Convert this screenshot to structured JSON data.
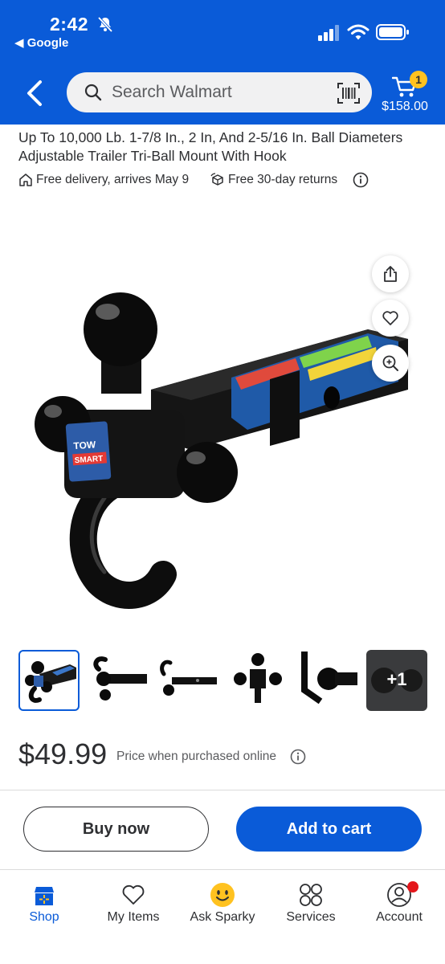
{
  "status_bar": {
    "time": "2:42",
    "back_app": "◀ Google"
  },
  "header": {
    "search_placeholder": "Search Walmart",
    "cart_count": "1",
    "cart_total": "$158.00"
  },
  "product": {
    "title_line1": "Up To 10,000 Lb. 1-7/8 In., 2 In, And 2-5/16 In. Ball Diameters",
    "title_line2": "Adjustable Trailer Tri-Ball Mount With Hook",
    "delivery": "Free delivery, arrives May 9",
    "returns": "Free 30-day returns",
    "brand_line1": "TOW",
    "brand_line2": "SMART",
    "price": "$49.99",
    "price_note": "Price when purchased online"
  },
  "gallery": {
    "more_label": "+1"
  },
  "actions": {
    "buy_now": "Buy now",
    "add_to_cart": "Add to cart"
  },
  "bottom_nav": {
    "tabs": [
      {
        "label": "Shop"
      },
      {
        "label": "My Items"
      },
      {
        "label": "Ask Sparky"
      },
      {
        "label": "Services"
      },
      {
        "label": "Account"
      }
    ]
  },
  "colors": {
    "brand_blue": "#0a5bd8",
    "spark_yellow": "#ffc220",
    "alert_red": "#e4161b"
  }
}
